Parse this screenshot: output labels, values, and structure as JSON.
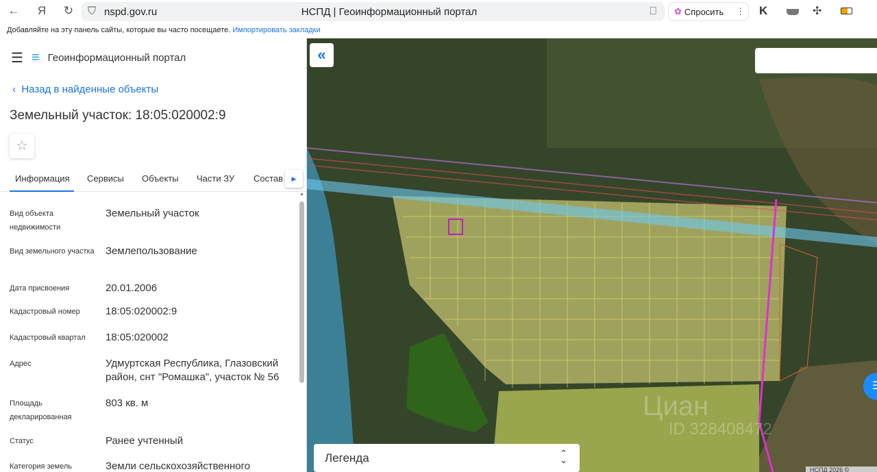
{
  "browser": {
    "url": "nspd.gov.ru",
    "tab_title": "НСПД | Геоинформационный портал",
    "ask_label": "Спросить",
    "bookmarks_text": "Добавляйте на эту панель сайты, которые вы часто посещаете.",
    "bookmarks_link": "Импортировать закладки"
  },
  "sidebar": {
    "portal_name": "Геоинформационный портал",
    "back_label": "Назад в найденные объекты",
    "title": "Земельный участок: 18:05:020002:9",
    "tabs": [
      "Информация",
      "Сервисы",
      "Объекты",
      "Части ЗУ",
      "Состав"
    ],
    "fields": [
      {
        "label": "Вид объекта недвижимости",
        "value": "Земельный участок"
      },
      {
        "label": "Вид земельного участка",
        "value": "Землепользование"
      },
      {
        "label": "Дата присвоения",
        "value": "20.01.2006"
      },
      {
        "label": "Кадастровый номер",
        "value": "18:05:020002:9"
      },
      {
        "label": "Кадастровый квартал",
        "value": "18:05:020002"
      },
      {
        "label": "Адрес",
        "value": "Удмуртская Республика, Глазовский район, снт \"Ромашка\", участок № 56"
      },
      {
        "label": "Площадь декларированная",
        "value": "803 кв. м"
      },
      {
        "label": "Статус",
        "value": "Ранее учтенный"
      },
      {
        "label": "Категория земель",
        "value": "Земли сельскохозяйственного"
      }
    ]
  },
  "map": {
    "legend_label": "Легенда",
    "copyright": "НСПД 2026 ©",
    "watermark": "Циан",
    "watermark_id": "ID 328408472"
  }
}
